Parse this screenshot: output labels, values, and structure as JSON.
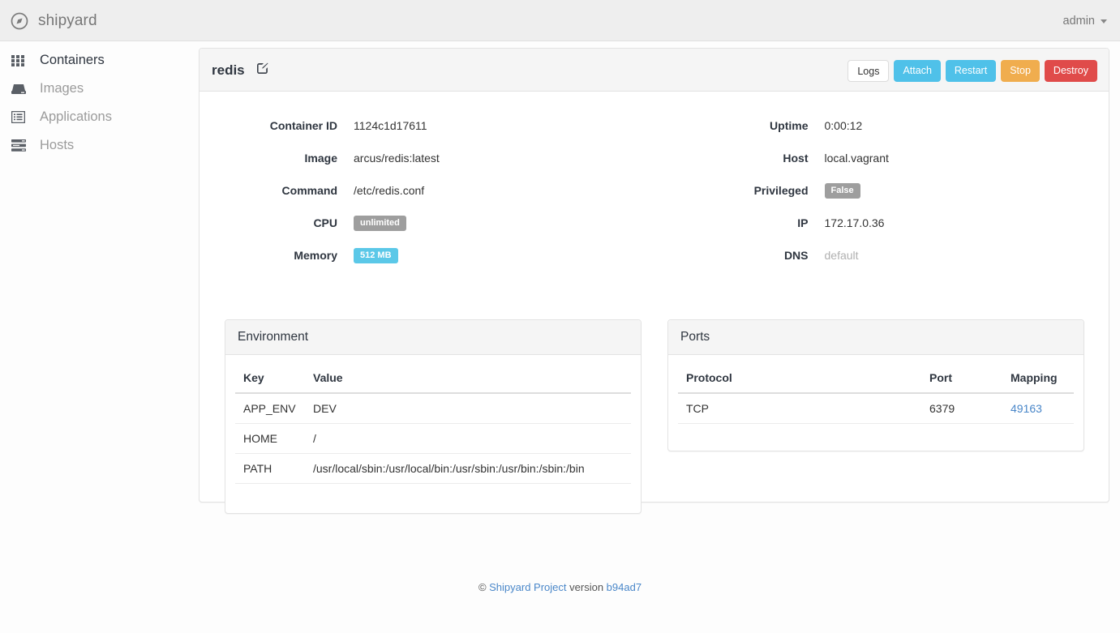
{
  "navbar": {
    "brand": "shipyard",
    "brand_icon": "compass-icon",
    "user": "admin",
    "caret_icon": "caret-down-icon"
  },
  "sidebar": {
    "items": [
      {
        "label": "Containers",
        "icon": "grid-icon",
        "active": true
      },
      {
        "label": "Images",
        "icon": "hdd-icon",
        "active": false
      },
      {
        "label": "Applications",
        "icon": "list-alt-icon",
        "active": false
      },
      {
        "label": "Hosts",
        "icon": "server-icon",
        "active": false
      }
    ]
  },
  "panel": {
    "title": "redis",
    "edit_icon": "edit-square-icon",
    "actions": [
      {
        "label": "Logs",
        "style": "default"
      },
      {
        "label": "Attach",
        "style": "info"
      },
      {
        "label": "Restart",
        "style": "info"
      },
      {
        "label": "Stop",
        "style": "warning"
      },
      {
        "label": "Destroy",
        "style": "danger"
      }
    ]
  },
  "details": {
    "left": [
      {
        "label": "Container ID",
        "value": "1124c1d17611",
        "kind": "text"
      },
      {
        "label": "Image",
        "value": "arcus/redis:latest",
        "kind": "text"
      },
      {
        "label": "Command",
        "value": "/etc/redis.conf",
        "kind": "text"
      },
      {
        "label": "CPU",
        "value": "unlimited",
        "kind": "badge-default"
      },
      {
        "label": "Memory",
        "value": "512 MB",
        "kind": "badge-info"
      }
    ],
    "right": [
      {
        "label": "Uptime",
        "value": "0:00:12",
        "kind": "text"
      },
      {
        "label": "Host",
        "value": "local.vagrant",
        "kind": "text"
      },
      {
        "label": "Privileged",
        "value": "False",
        "kind": "badge-default"
      },
      {
        "label": "IP",
        "value": "172.17.0.36",
        "kind": "text"
      },
      {
        "label": "DNS",
        "value": "default",
        "kind": "muted"
      }
    ]
  },
  "environment": {
    "title": "Environment",
    "columns": [
      "Key",
      "Value"
    ],
    "rows": [
      [
        "APP_ENV",
        "DEV"
      ],
      [
        "HOME",
        "/"
      ],
      [
        "PATH",
        "/usr/local/sbin:/usr/local/bin:/usr/sbin:/usr/bin:/sbin:/bin"
      ]
    ]
  },
  "ports": {
    "title": "Ports",
    "columns": [
      "Protocol",
      "Port",
      "Mapping"
    ],
    "rows": [
      {
        "protocol": "TCP",
        "port": "6379",
        "mapping": "49163"
      }
    ]
  },
  "footer": {
    "copyright": "© ",
    "project": "Shipyard Project",
    "version_label": " version ",
    "version": "b94ad7"
  },
  "colors": {
    "info": "#4fc1e9",
    "warning": "#f0ad4e",
    "danger": "#e04b4a",
    "badge_default": "#9e9e9e",
    "badge_info": "#5bc8e8",
    "link": "#4a87c9",
    "navbar_bg": "#eeeeee",
    "panel_head_bg": "#f5f5f5"
  }
}
